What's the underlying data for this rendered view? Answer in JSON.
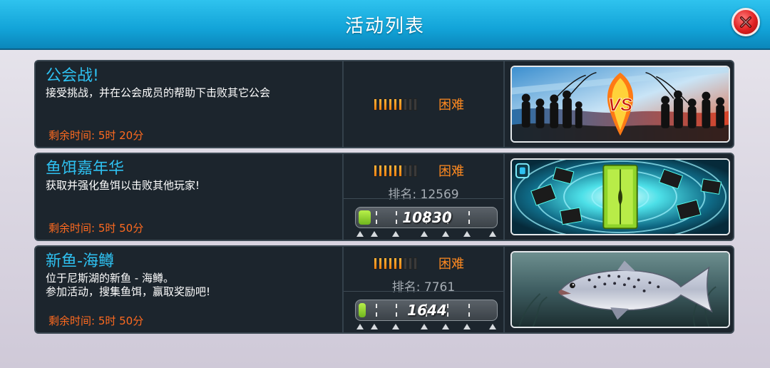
{
  "header": {
    "title": "活动列表",
    "close_icon": "close-icon"
  },
  "difficulty_bars": {
    "total": 9,
    "filled": 6
  },
  "events": [
    {
      "title": "公会战!",
      "description": [
        "接受挑战，并在公会成员的帮助下击败其它公会"
      ],
      "remaining": "剩余时间:  5时 20分",
      "difficulty": "困难",
      "rank": null,
      "score": null,
      "image": "guild-war-vs-icon"
    },
    {
      "title": "鱼饵嘉年华",
      "description": [
        "获取并强化鱼饵以击败其他玩家!"
      ],
      "remaining": "剩余时间:  5时 50分",
      "difficulty": "困难",
      "rank": "排名:  12569",
      "score": "10830",
      "progress": 0.09,
      "image": "lure-carnival-portal"
    },
    {
      "title": "新鱼-海鳟",
      "description": [
        "位于尼斯湖的新鱼 - 海鳟。",
        "参加活动，搜集鱼饵，赢取奖励吧!"
      ],
      "remaining": "剩余时间:  5时 50分",
      "difficulty": "困难",
      "rank": "排名:  7761",
      "score": "1644",
      "progress": 0.02,
      "image": "sea-trout-fish"
    }
  ],
  "colors": {
    "title": "#2ec0f0",
    "time": "#ff6a1f",
    "difficulty": "#ff8a20",
    "header": "#12a3d8"
  }
}
